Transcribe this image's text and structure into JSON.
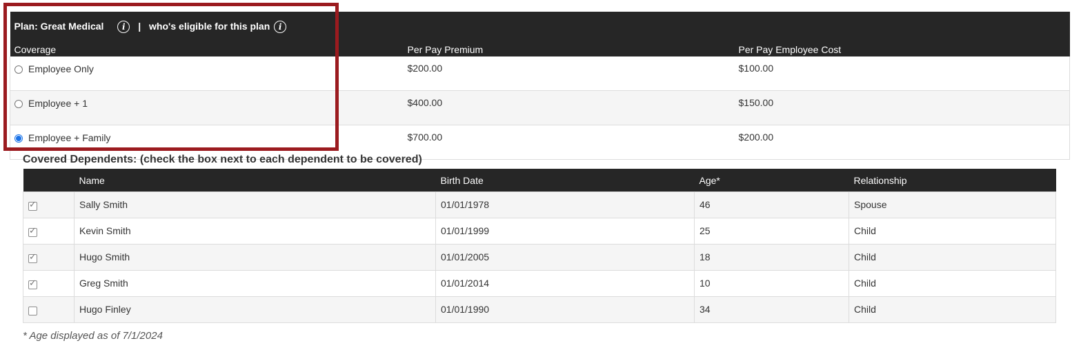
{
  "plan": {
    "title": "Plan: Great Medical",
    "separator": "|",
    "eligibility_label": "who's eligible for this plan",
    "info_icon_glyph": "i",
    "columns": [
      "Coverage",
      "Per Pay Premium",
      "Per Pay Employee Cost"
    ],
    "options": [
      {
        "label": "Employee Only",
        "premium": "$200.00",
        "cost": "$100.00",
        "selected": false
      },
      {
        "label": "Employee + 1",
        "premium": "$400.00",
        "cost": "$150.00",
        "selected": false
      },
      {
        "label": "Employee + Family",
        "premium": "$700.00",
        "cost": "$200.00",
        "selected": true
      }
    ],
    "highlight_color": "#9b1b1f"
  },
  "dependents": {
    "title": "Covered Dependents: (check the box next to each dependent to be covered)",
    "columns": [
      "",
      "Name",
      "Birth Date",
      "Age*",
      "Relationship"
    ],
    "rows": [
      {
        "checked": true,
        "name": "Sally Smith",
        "birth_date": "01/01/1978",
        "age": "46",
        "relationship": "Spouse"
      },
      {
        "checked": true,
        "name": "Kevin Smith",
        "birth_date": "01/01/1999",
        "age": "25",
        "relationship": "Child"
      },
      {
        "checked": true,
        "name": "Hugo Smith",
        "birth_date": "01/01/2005",
        "age": "18",
        "relationship": "Child"
      },
      {
        "checked": true,
        "name": "Greg Smith",
        "birth_date": "01/01/2014",
        "age": "10",
        "relationship": "Child"
      },
      {
        "checked": false,
        "name": "Hugo Finley",
        "birth_date": "01/01/1990",
        "age": "34",
        "relationship": "Child"
      }
    ],
    "footnote": "* Age displayed as of 7/1/2024"
  }
}
